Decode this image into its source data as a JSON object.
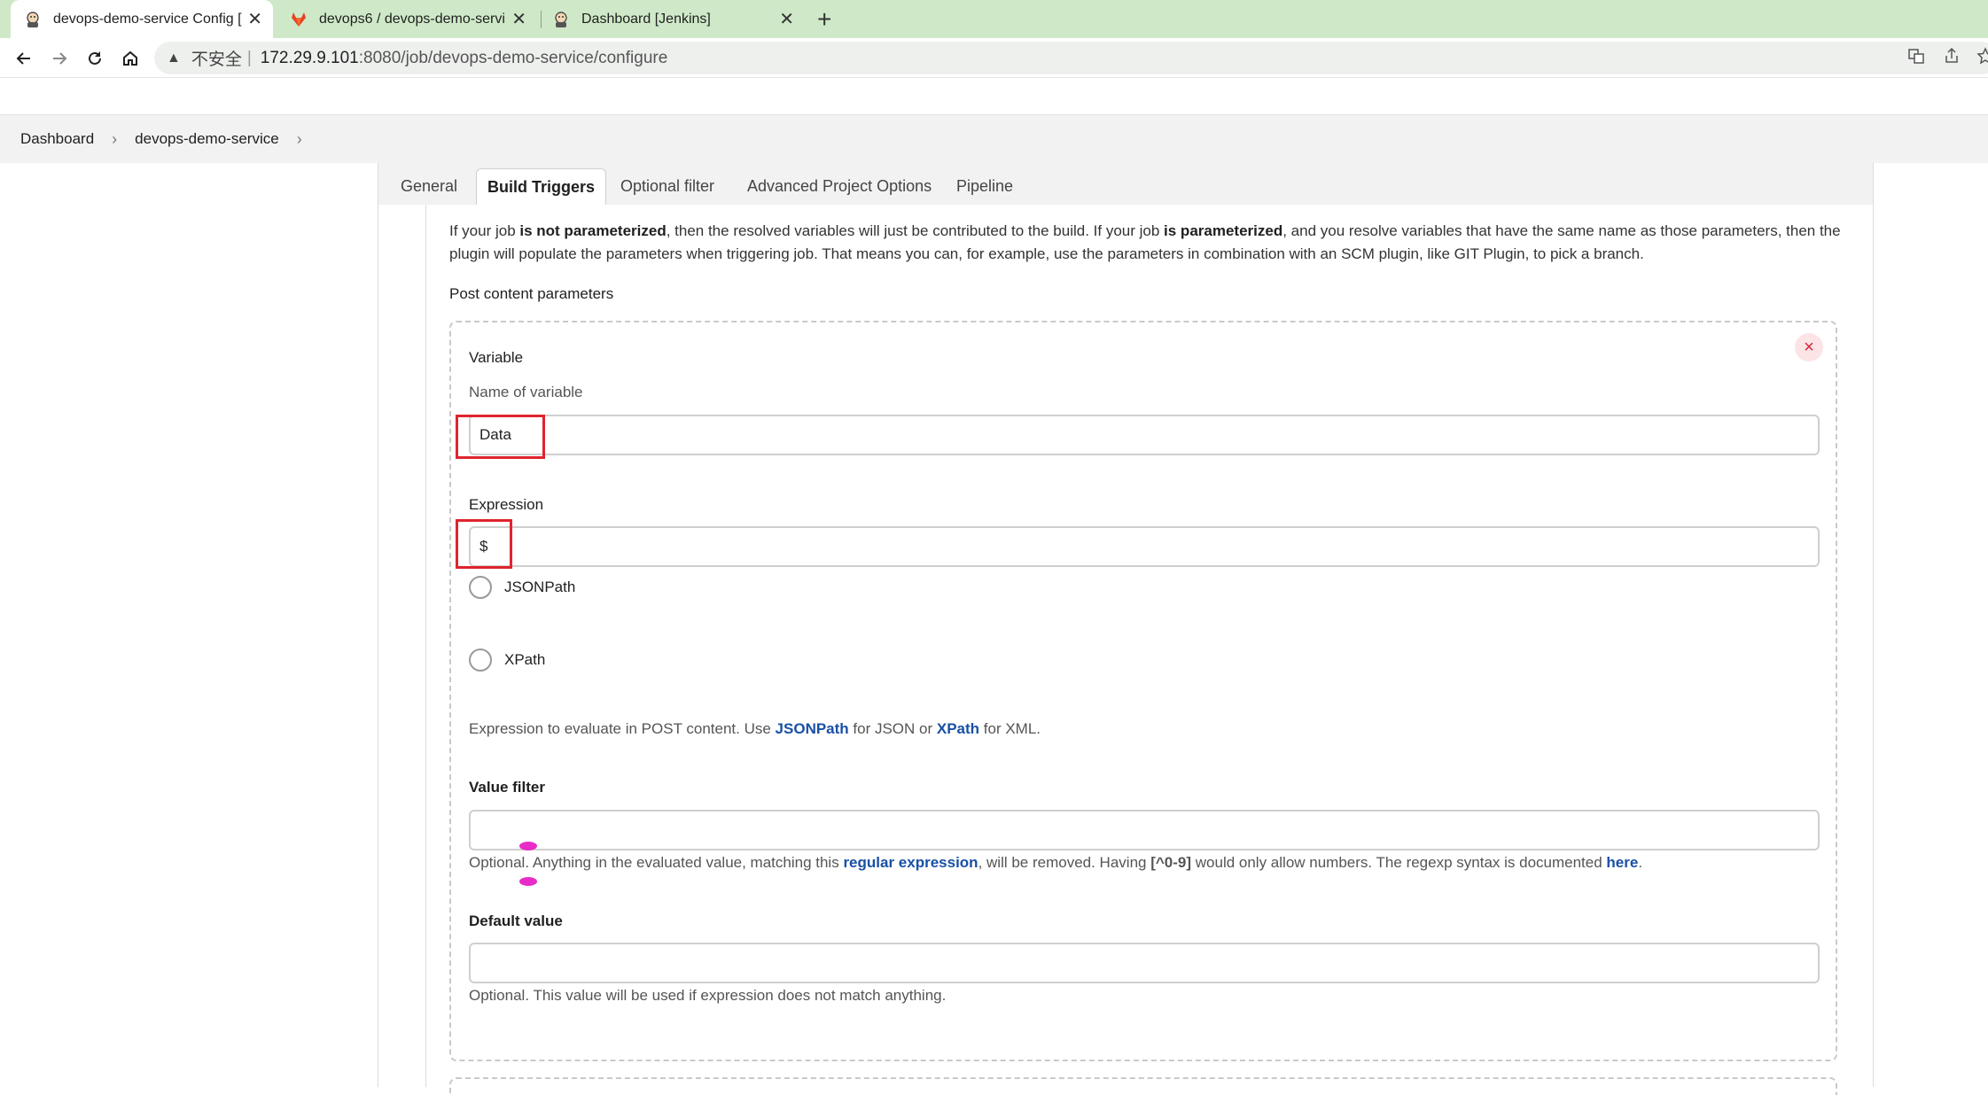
{
  "browser": {
    "tabs": [
      {
        "title": "devops-demo-service Config [",
        "icon": "jenkins-icon",
        "active": true
      },
      {
        "title": "devops6 / devops-demo-servi",
        "icon": "gitlab-icon",
        "active": false
      },
      {
        "title": "Dashboard [Jenkins]",
        "icon": "jenkins-icon",
        "active": false
      }
    ],
    "close_glyph": "✕",
    "new_tab_glyph": "+",
    "address": {
      "security_label": "不安全",
      "separator": "|",
      "host": "172.29.9.101",
      "path": ":8080/job/devops-demo-service/configure"
    }
  },
  "breadcrumb": {
    "items": [
      "Dashboard",
      "devops-demo-service"
    ],
    "separator": "›"
  },
  "config_tabs": [
    "General",
    "Build Triggers",
    "Optional filter",
    "Advanced Project Options",
    "Pipeline"
  ],
  "active_tab": "Build Triggers",
  "intro": {
    "p1": "If your job ",
    "b1": "is not parameterized",
    "p2": ", then the resolved variables will just be contributed to the build. If your job ",
    "b2": "is parameterized",
    "p3": ", and you resolve variables that have the same name as those parameters, then the plugin will populate the parameters when triggering job. That means you can, for example, use the parameters in combination with an SCM plugin, like GIT Plugin, to pick a branch."
  },
  "section_title": "Post content parameters",
  "param": {
    "close_glyph": "×",
    "variable_label": "Variable",
    "variable_help": "Name of variable",
    "variable_value": "Data",
    "expression_label": "Expression",
    "expression_value": "$",
    "options": [
      "JSONPath",
      "XPath"
    ],
    "expression_help": {
      "t1": "Expression to evaluate in POST content. Use ",
      "l1": "JSONPath",
      "t2": " for JSON or ",
      "l2": "XPath",
      "t3": " for XML."
    },
    "value_filter_label": "Value filter",
    "value_filter_value": "",
    "value_filter_help": {
      "t1": "Optional. Anything in the evaluated value, matching this ",
      "l1": "regular expression",
      "t2": ", will be removed. Having ",
      "code": "[^0-9]",
      "t3": " would only allow numbers. The regexp syntax is documented ",
      "l2": "here",
      "t4": "."
    },
    "default_value_label": "Default value",
    "default_value_value": "",
    "default_value_help": "Optional. This value will be used if expression does not match anything."
  },
  "colors": {
    "tabbar": "#cfe9c8",
    "annotation": "#e0242d",
    "link": "#1950a6",
    "close": "#d6233b"
  }
}
